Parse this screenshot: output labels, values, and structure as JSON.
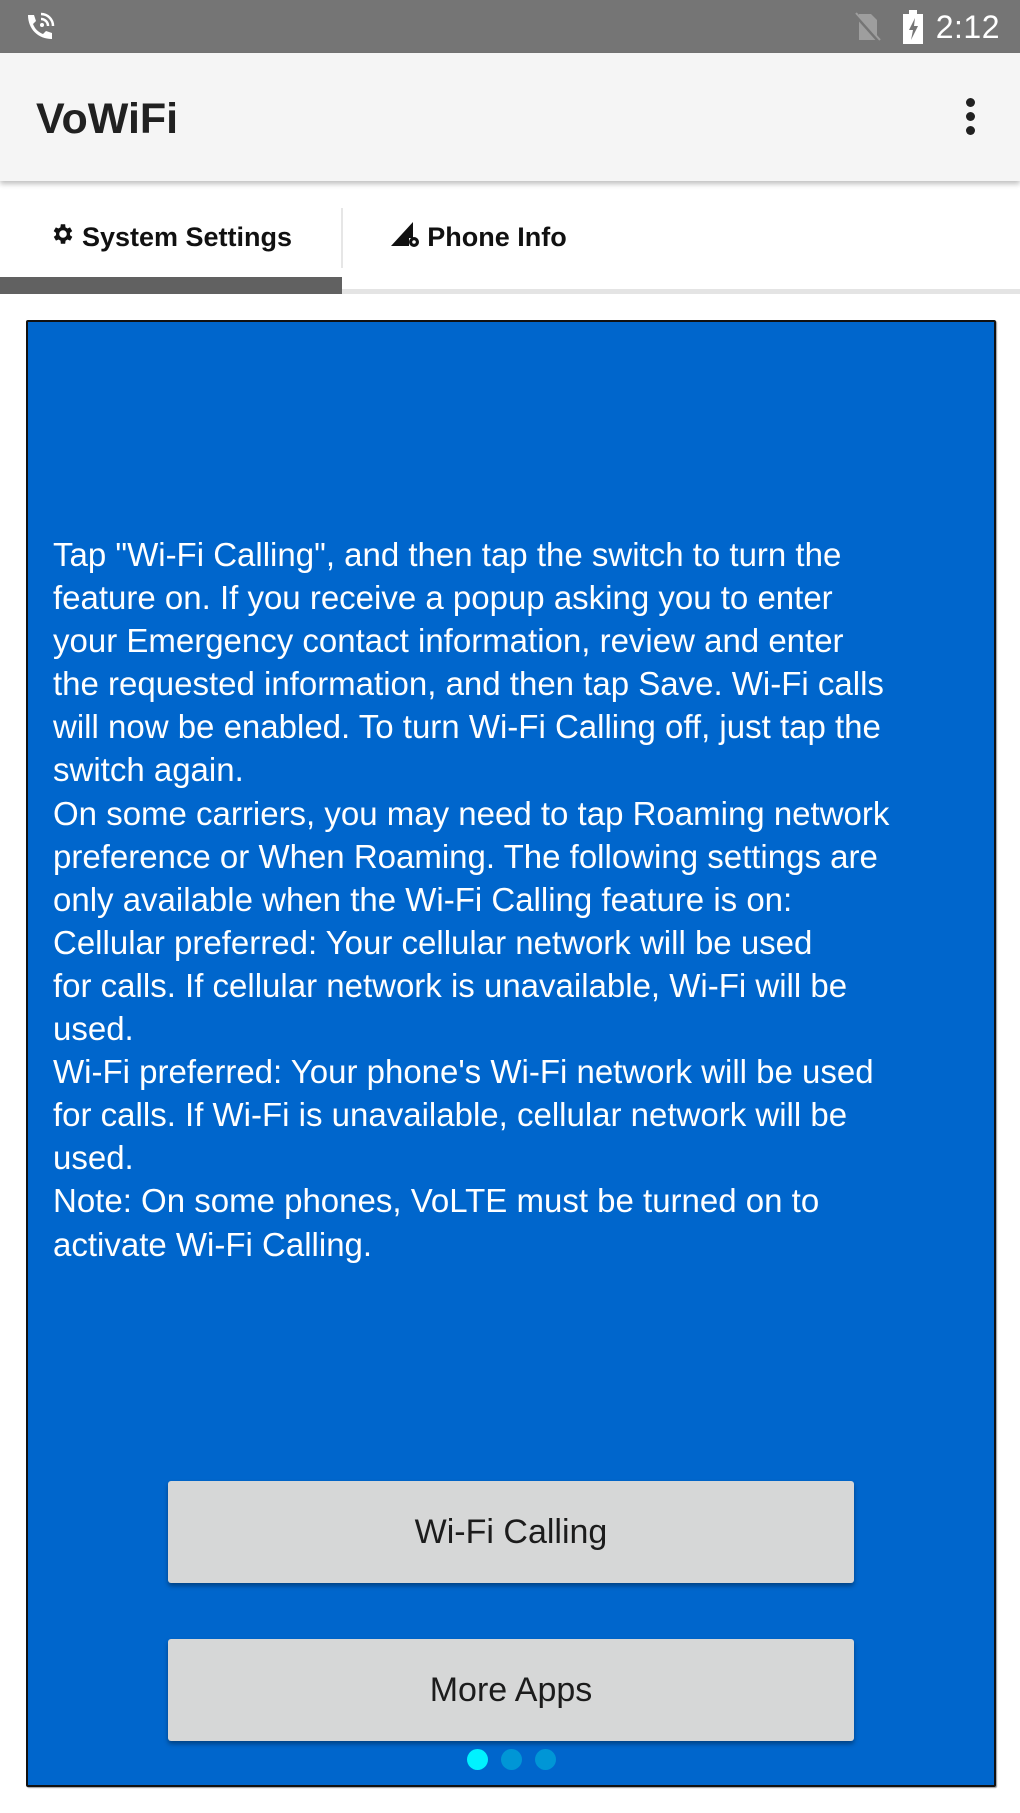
{
  "status_bar": {
    "left_icons": [
      "wifi-calling-icon"
    ],
    "right_icons": [
      "no-sim-icon",
      "battery-charging-icon"
    ],
    "time": "2:12"
  },
  "toolbar": {
    "title": "VoWiFi",
    "overflow_icon": "more-vert-icon"
  },
  "tabs": [
    {
      "label": "System Settings",
      "icon": "gear-icon",
      "selected": true
    },
    {
      "label": "Phone Info",
      "icon": "signal-settings-icon",
      "selected": false
    }
  ],
  "panel": {
    "background": "#0066CC",
    "description_lines": [
      "Tap \"Wi-Fi Calling\", and then tap the switch to turn the",
      "feature on. If you receive a popup asking you to enter",
      "your Emergency contact information, review and enter",
      "the requested information, and then tap Save. Wi-Fi calls",
      "will now be enabled. To turn Wi-Fi Calling off, just tap the",
      "switch again.",
      "On some carriers, you may need to tap Roaming network",
      "preference or When Roaming. The following settings are",
      "only available when the Wi-Fi Calling feature is on:",
      "Cellular preferred: Your cellular network will be used",
      "for calls. If cellular network is unavailable, Wi-Fi will be",
      "used.",
      "Wi-Fi preferred: Your phone's Wi-Fi network will be used",
      "for calls. If Wi-Fi is unavailable, cellular network will be",
      "used.",
      "Note: On some phones, VoLTE must be turned on to",
      "activate Wi-Fi Calling."
    ],
    "buttons": {
      "wifi_calling": "Wi-Fi Calling",
      "more_apps": "More Apps"
    },
    "page_indicator": {
      "total_pages": 3,
      "current_page": 1,
      "active_color": "#00F2FF",
      "inactive_color": "#0096D6"
    }
  }
}
